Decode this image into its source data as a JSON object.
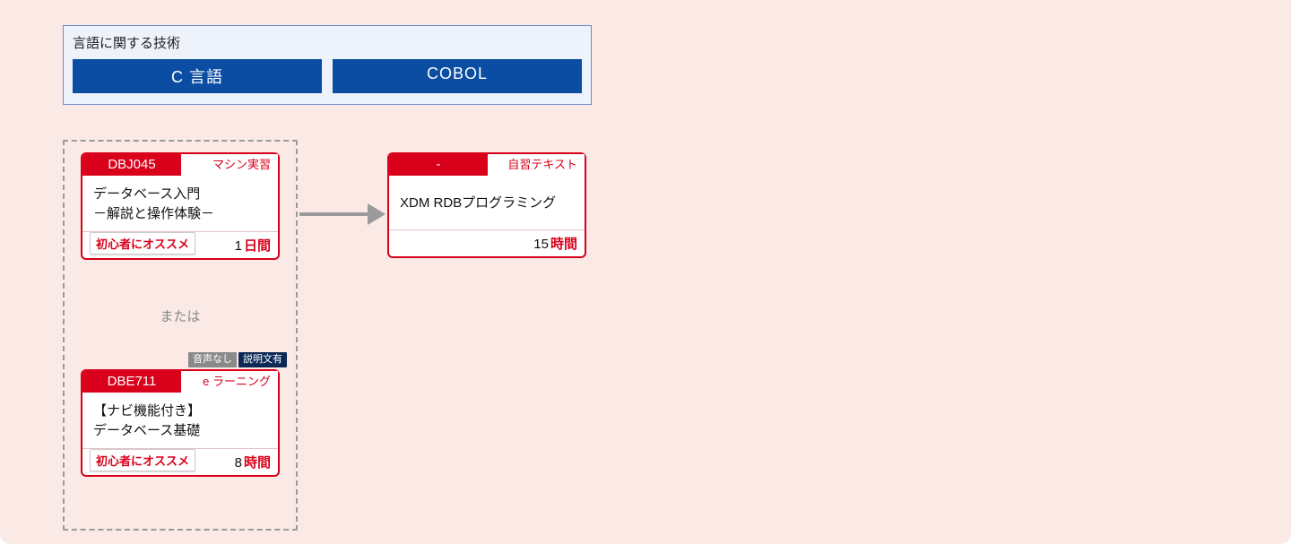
{
  "category": {
    "title": "言語に関する技術",
    "buttons": [
      "C 言語",
      "COBOL"
    ]
  },
  "group": {
    "or_label": "または"
  },
  "cards": {
    "c1": {
      "code": "DBJ045",
      "type": "マシン実習",
      "title_l1": "データベース入門",
      "title_l2": "－解説と操作体験－",
      "recommend": "初心者にオススメ",
      "duration_num": "1",
      "duration_unit": "日間"
    },
    "c2": {
      "code": "DBE711",
      "type": "e ラーニング",
      "title_l1": "【ナビ機能付き】",
      "title_l2": "データベース基礎",
      "recommend": "初心者にオススメ",
      "duration_num": "8",
      "duration_unit": "時間",
      "pill1": "音声なし",
      "pill2": "説明文有"
    },
    "c3": {
      "code": "-",
      "type": "自習テキスト",
      "title_l1": "XDM RDBプログラミング",
      "duration_num": "15",
      "duration_unit": "時間"
    }
  }
}
